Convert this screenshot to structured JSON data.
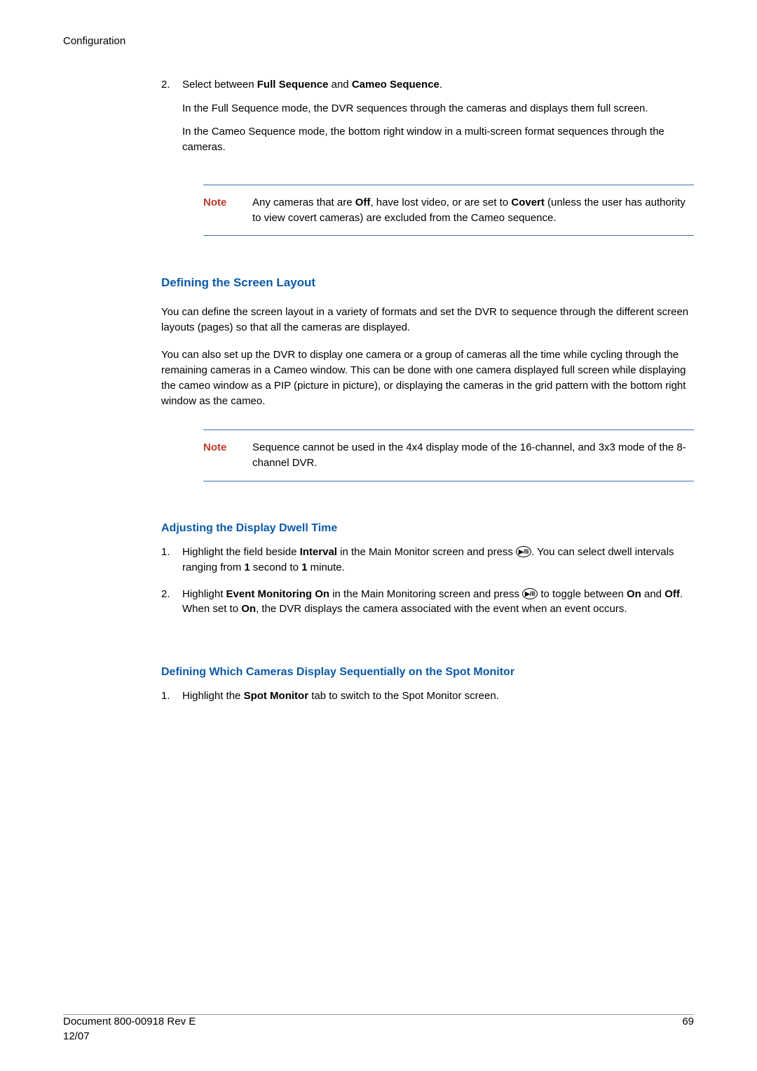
{
  "header": "Configuration",
  "step2": {
    "num": "2.",
    "line1_a": "Select between ",
    "line1_b": "Full Sequence",
    "line1_c": " and ",
    "line1_d": "Cameo Sequence",
    "line1_e": ".",
    "p2": "In the Full Sequence mode, the DVR sequences through the cameras and displays them full screen.",
    "p3": "In the Cameo Sequence mode, the bottom right window in a multi-screen format sequences through the cameras."
  },
  "note1": {
    "label": "Note",
    "t1": "Any cameras that are ",
    "t2": "Off",
    "t3": ", have lost video, or are set to ",
    "t4": "Covert",
    "t5": " (unless the user has authority to view covert cameras) are excluded from the Cameo sequence."
  },
  "section1": {
    "title": "Defining the Screen Layout",
    "p1": "You can define the screen layout in a variety of formats and set the DVR to sequence through the different screen layouts (pages) so that all the cameras are displayed.",
    "p2": "You can also set up the DVR to display one camera or a group of cameras all the time while cycling through the remaining cameras in a Cameo window. This can be done with one camera displayed full screen while displaying the cameo window as a PIP (picture in picture), or displaying the cameras in the grid pattern with the bottom right window as the cameo."
  },
  "note2": {
    "label": "Note",
    "text": "Sequence cannot be used in the 4x4 display mode of the 16-channel, and 3x3 mode of the 8-channel DVR."
  },
  "section2": {
    "title": "Adjusting the Display Dwell Time",
    "s1": {
      "num": "1.",
      "a": "Highlight the field beside ",
      "b": "Interval",
      "c": " in the Main Monitor screen and press ",
      "d": ". You can select dwell intervals ranging from ",
      "e": "1",
      "f": " second to ",
      "g": "1",
      "h": " minute."
    },
    "s2": {
      "num": "2.",
      "a": "Highlight ",
      "b": "Event Monitoring On",
      "c": " in the Main Monitoring screen and press ",
      "d": " to toggle between ",
      "e": "On",
      "f": " and ",
      "g": "Off",
      "h": ". When set to ",
      "i": "On",
      "j": ", the DVR displays the camera associated with the event when an event occurs."
    }
  },
  "section3": {
    "title": "Defining Which Cameras Display Sequentially on the Spot Monitor",
    "s1": {
      "num": "1.",
      "a": "Highlight the ",
      "b": "Spot Monitor",
      "c": " tab to switch to the Spot Monitor screen."
    }
  },
  "icon": "▶/II",
  "footer": {
    "leftLine1": "Document 800-00918 Rev E",
    "leftLine2": "12/07",
    "right": "69"
  }
}
